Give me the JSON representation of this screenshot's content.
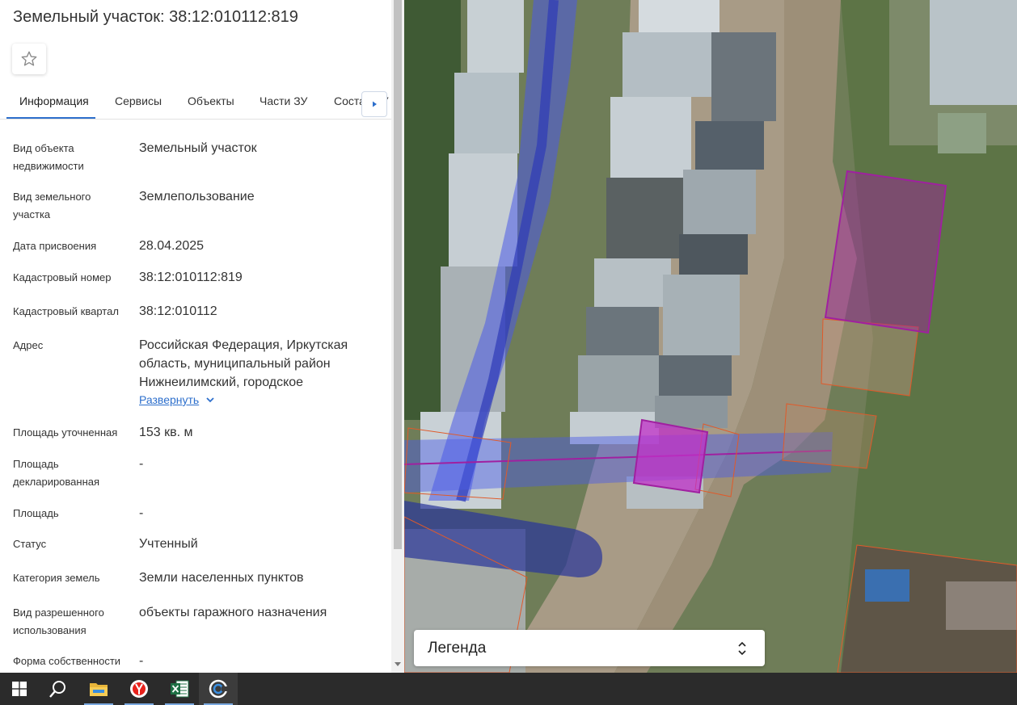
{
  "panel": {
    "title": "Земельный участок: 38:12:010112:819",
    "tabs": [
      {
        "label": "Информация"
      },
      {
        "label": "Сервисы"
      },
      {
        "label": "Объекты"
      },
      {
        "label": "Части ЗУ"
      },
      {
        "label": "Состав ЗУ"
      }
    ],
    "fields": [
      {
        "label": "Вид объекта недвижимости",
        "value": "Земельный участок"
      },
      {
        "label": "Вид земельного участка",
        "value": "Землепользование"
      },
      {
        "label": "Дата присвоения",
        "value": "28.04.2025"
      },
      {
        "label": "Кадастровый номер",
        "value": "38:12:010112:819"
      },
      {
        "label": "Кадастровый квартал",
        "value": "38:12:010112"
      },
      {
        "label": "Адрес",
        "value": "Российская Федерация, Иркутская область, муниципальный район Нижнеилимский, городское"
      },
      {
        "label": "Площадь уточненная",
        "value": "153 кв. м"
      },
      {
        "label": "Площадь декларированная",
        "value": "-"
      },
      {
        "label": "Площадь",
        "value": "-"
      },
      {
        "label": "Статус",
        "value": "Учтенный"
      },
      {
        "label": "Категория земель",
        "value": "Земли населенных пунктов"
      },
      {
        "label": "Вид разрешенного использования",
        "value": "объекты гаражного назначения"
      },
      {
        "label": "Форма собственности",
        "value": "-"
      }
    ],
    "expand_label": "Развернуть"
  },
  "map": {
    "legend_label": "Легенда"
  },
  "colors": {
    "accent": "#2d6fcc",
    "parcel_selected": "#a020a0",
    "parcel_border": "#e05a2a",
    "utility_zone": "#4a5ae8"
  }
}
